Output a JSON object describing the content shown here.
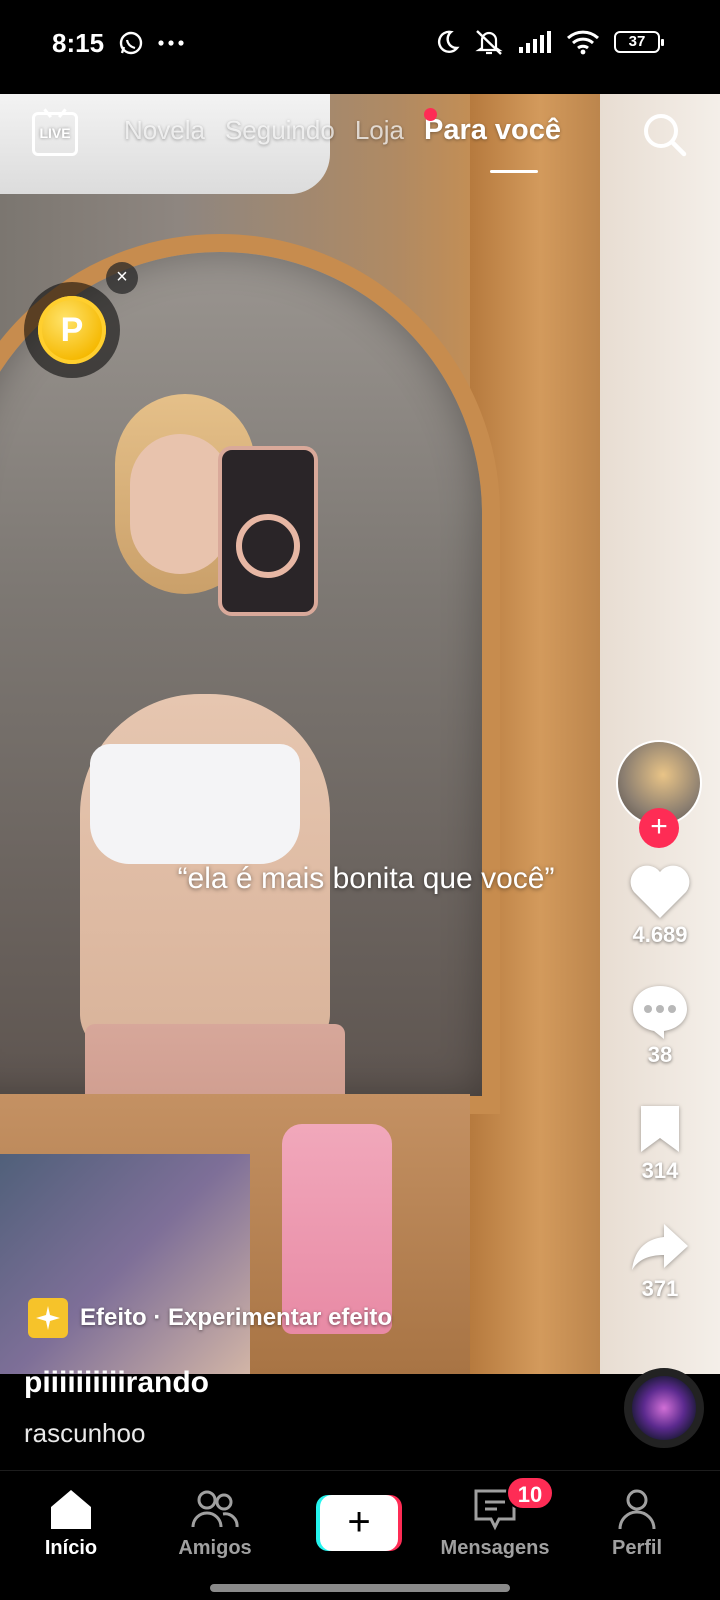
{
  "status_bar": {
    "time": "8:15",
    "battery": "37"
  },
  "top_nav": {
    "live_label": "LIVE",
    "tabs": [
      {
        "label": "Novela"
      },
      {
        "label": "Seguindo"
      },
      {
        "label": "Loja"
      },
      {
        "label": "Para você"
      }
    ]
  },
  "coin": {
    "letter": "P",
    "close": "×"
  },
  "video": {
    "overlay_text": "“ela é mais bonita que você”"
  },
  "actions": {
    "follow": "+",
    "likes": "4.689",
    "comments": "38",
    "saves": "314",
    "shares": "371"
  },
  "effect": {
    "label": "Efeito · Experimentar efeito"
  },
  "post": {
    "username": "piiiiiiiiiirando",
    "caption": "rascunhoo"
  },
  "bottom_nav": {
    "items": [
      {
        "label": "Início"
      },
      {
        "label": "Amigos"
      },
      {
        "label": "+"
      },
      {
        "label": "Mensagens"
      },
      {
        "label": "Perfil"
      }
    ],
    "messages_badge": "10"
  },
  "colors": {
    "accent": "#fe2c55",
    "cyan": "#25f4ee",
    "coin": "#f5b800"
  }
}
